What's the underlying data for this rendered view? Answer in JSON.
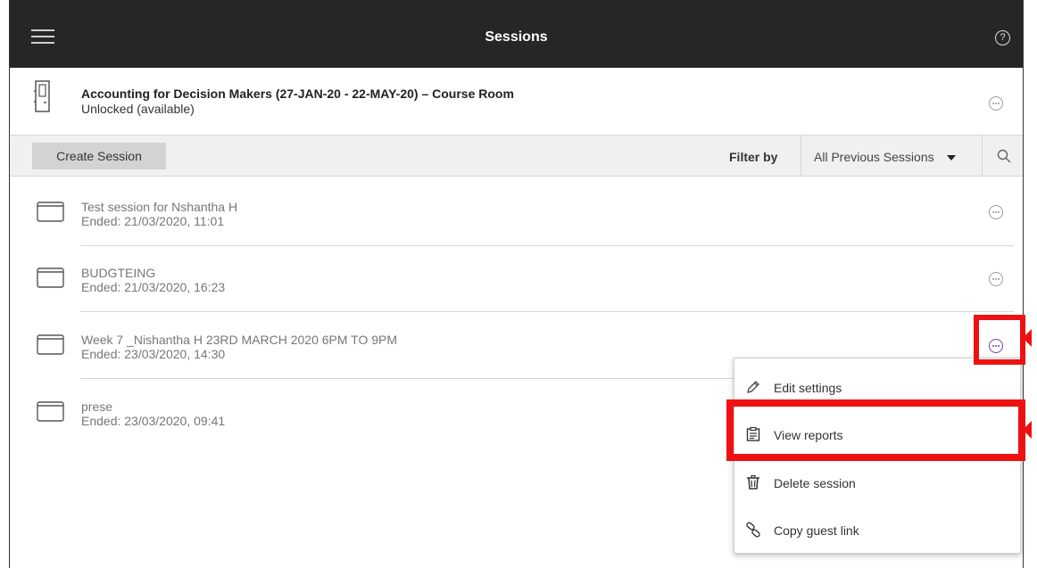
{
  "header": {
    "title": "Sessions",
    "menu_icon": "hamburger-icon",
    "help_glyph": "?"
  },
  "course": {
    "name": "Accounting for Decision Makers (27-JAN-20 - 22-MAY-20) – Course Room",
    "status": "Unlocked (available)"
  },
  "toolbar": {
    "create_label": "Create Session",
    "filter_label": "Filter by",
    "filter_value": "All Previous Sessions"
  },
  "sessions": [
    {
      "name": "Test session for Nshantha H",
      "ended": "Ended: 21/03/2020, 11:01"
    },
    {
      "name": "BUDGTEING",
      "ended": "Ended: 21/03/2020, 16:23"
    },
    {
      "name": "Week 7 _Nishantha H 23RD MARCH 2020 6PM TO 9PM",
      "ended": "Ended: 23/03/2020, 14:30"
    },
    {
      "name": "prese",
      "ended": "Ended: 23/03/2020, 09:41"
    }
  ],
  "context_menu": {
    "items": [
      {
        "label": "Edit settings",
        "icon": "pencil-icon"
      },
      {
        "label": "View reports",
        "icon": "report-icon"
      },
      {
        "label": "Delete session",
        "icon": "trash-icon"
      },
      {
        "label": "Copy guest link",
        "icon": "link-icon"
      }
    ]
  },
  "colors": {
    "header_bg": "#262626",
    "highlight": "#ee1111",
    "active_more": "#7b3fa3"
  }
}
